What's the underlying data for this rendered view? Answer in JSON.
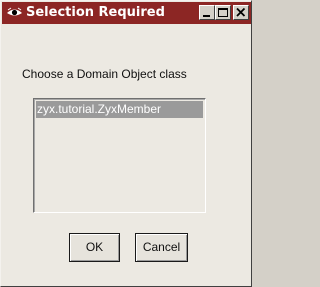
{
  "window": {
    "title": "Selection Required",
    "title_bar_color": "#8c2624"
  },
  "dialog": {
    "prompt": "Choose a Domain Object class",
    "list_items": [
      {
        "label": "zyx.tutorial.ZyxMember",
        "selected": true
      }
    ],
    "ok_label": "OK",
    "cancel_label": "Cancel"
  },
  "icons": {
    "app": "eye-icon",
    "minimize": "minimize-icon",
    "maximize": "maximize-icon",
    "close": "close-icon"
  }
}
